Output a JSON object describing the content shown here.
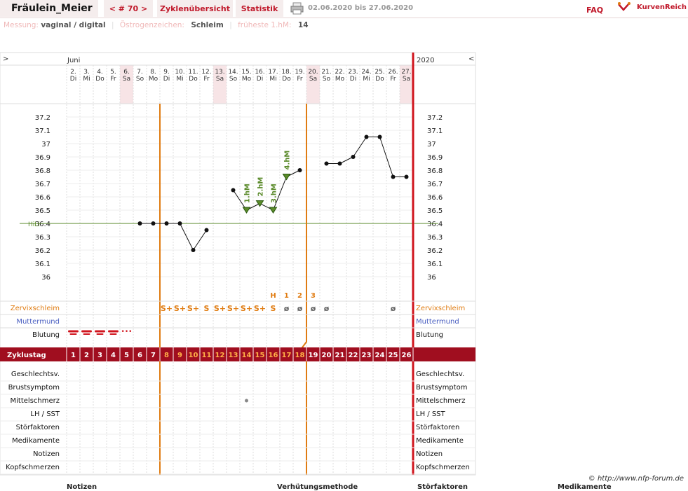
{
  "header": {
    "username": "Fräulein_Meier",
    "cycle_nav": "< # 70 >",
    "tab_overview": "Zyklenübersicht",
    "tab_stats": "Statistik",
    "date_range": "02.06.2020 bis 27.06.2020",
    "faq": "FAQ",
    "brand": "KurvenReich"
  },
  "measurement": {
    "messung_label": "Messung:",
    "messung_value": "vaginal / digital",
    "oestro_label": "Östrogenzeichen:",
    "oestro_value": "Schleim",
    "hm_label": "früheste 1.hM:",
    "hm_value": "14"
  },
  "chart_data": {
    "type": "line",
    "month_label": "Juni",
    "year_label": "2020",
    "nav_left": ">",
    "nav_right": "<",
    "days": [
      {
        "date": "2.",
        "wd": "Di",
        "weekend": false
      },
      {
        "date": "3.",
        "wd": "Mi",
        "weekend": false
      },
      {
        "date": "4.",
        "wd": "Do",
        "weekend": false
      },
      {
        "date": "5.",
        "wd": "Fr",
        "weekend": false
      },
      {
        "date": "6.",
        "wd": "Sa",
        "weekend": true
      },
      {
        "date": "7.",
        "wd": "So",
        "weekend": false
      },
      {
        "date": "8.",
        "wd": "Mo",
        "weekend": false
      },
      {
        "date": "9.",
        "wd": "Di",
        "weekend": false
      },
      {
        "date": "10.",
        "wd": "Mi",
        "weekend": false
      },
      {
        "date": "11.",
        "wd": "Do",
        "weekend": false
      },
      {
        "date": "12.",
        "wd": "Fr",
        "weekend": false
      },
      {
        "date": "13.",
        "wd": "Sa",
        "weekend": true
      },
      {
        "date": "14.",
        "wd": "So",
        "weekend": false
      },
      {
        "date": "15.",
        "wd": "Mo",
        "weekend": false
      },
      {
        "date": "16.",
        "wd": "Di",
        "weekend": false
      },
      {
        "date": "17.",
        "wd": "Mi",
        "weekend": false
      },
      {
        "date": "18.",
        "wd": "Do",
        "weekend": false
      },
      {
        "date": "19.",
        "wd": "Fr",
        "weekend": false
      },
      {
        "date": "20.",
        "wd": "Sa",
        "weekend": true
      },
      {
        "date": "21.",
        "wd": "So",
        "weekend": false
      },
      {
        "date": "22.",
        "wd": "Mo",
        "weekend": false
      },
      {
        "date": "23.",
        "wd": "Di",
        "weekend": false
      },
      {
        "date": "24.",
        "wd": "Mi",
        "weekend": false
      },
      {
        "date": "25.",
        "wd": "Do",
        "weekend": false
      },
      {
        "date": "26.",
        "wd": "Fr",
        "weekend": false
      },
      {
        "date": "27.",
        "wd": "Sa",
        "weekend": true
      }
    ],
    "y_ticks": [
      "37.2",
      "37.1",
      "37",
      "36.9",
      "36.8",
      "36.7",
      "36.6",
      "36.5",
      "36.4",
      "36.3",
      "36.2",
      "36.1",
      "36"
    ],
    "ylim": [
      36.0,
      37.2
    ],
    "hil_label": "HiLi",
    "hil_value": 36.4,
    "temperatures": [
      null,
      null,
      null,
      null,
      null,
      36.4,
      36.4,
      36.4,
      36.4,
      36.2,
      36.35,
      null,
      36.65,
      36.5,
      36.55,
      36.5,
      36.75,
      36.8,
      null,
      36.85,
      36.85,
      36.9,
      37.05,
      37.05,
      36.75,
      36.75
    ],
    "high_measurements": [
      {
        "day": 13,
        "label": "1.hM"
      },
      {
        "day": 14,
        "label": "2.hM"
      },
      {
        "day": 15,
        "label": "3.hM"
      },
      {
        "day": 16,
        "label": "4.hM"
      }
    ],
    "peak_markers": [
      {
        "day": 15,
        "label": "H"
      },
      {
        "day": 16,
        "label": "1"
      },
      {
        "day": 17,
        "label": "2"
      },
      {
        "day": 18,
        "label": "3"
      }
    ],
    "cervix_mucus": [
      "",
      "",
      "",
      "",
      "",
      "",
      "",
      "S+",
      "S+",
      "S+",
      "S",
      "S+",
      "S+",
      "S+",
      "S+",
      "S",
      "ø",
      "ø",
      "ø",
      "ø",
      "",
      "",
      "",
      "",
      "ø",
      ""
    ],
    "bleeding": [
      3,
      3,
      3,
      3,
      1,
      0,
      0,
      0,
      0,
      0,
      0,
      0,
      0,
      0,
      0,
      0,
      0,
      0,
      0,
      0,
      0,
      0,
      0,
      0,
      0,
      0
    ],
    "mittelschmerz_day": 13,
    "cycle_days": [
      "1",
      "2",
      "3",
      "4",
      "5",
      "6",
      "7",
      "8",
      "9",
      "10",
      "11",
      "12",
      "13",
      "14",
      "15",
      "16",
      "17",
      "18",
      "19",
      "20",
      "21",
      "22",
      "23",
      "24",
      "25",
      "26"
    ],
    "fertile_window": [
      8,
      18
    ]
  },
  "rows": {
    "zervix": "Zervixschleim",
    "muttermund": "Muttermund",
    "blutung": "Blutung",
    "zyklustag": "Zyklustag",
    "lower": [
      "Geschlechtsv.",
      "Brustsymptom",
      "Mittelschmerz",
      "LH / SST",
      "Störfaktoren",
      "Medikamente",
      "Notizen",
      "Kopfschmerzen"
    ]
  },
  "footer": {
    "copyright": "© http://www.nfp-forum.de",
    "bottom_labels": [
      "Notizen",
      "Verhütungsmethode",
      "Störfaktoren",
      "Medikamente"
    ]
  },
  "colors": {
    "accent": "#c0182a",
    "orange": "#e07c12",
    "zyklus_bar": "#a00e1f",
    "hil": "#5a8a2a",
    "hm_green": "#5a8a2a",
    "weekend": "#f7e4e6",
    "blue": "#4a5fc1"
  }
}
